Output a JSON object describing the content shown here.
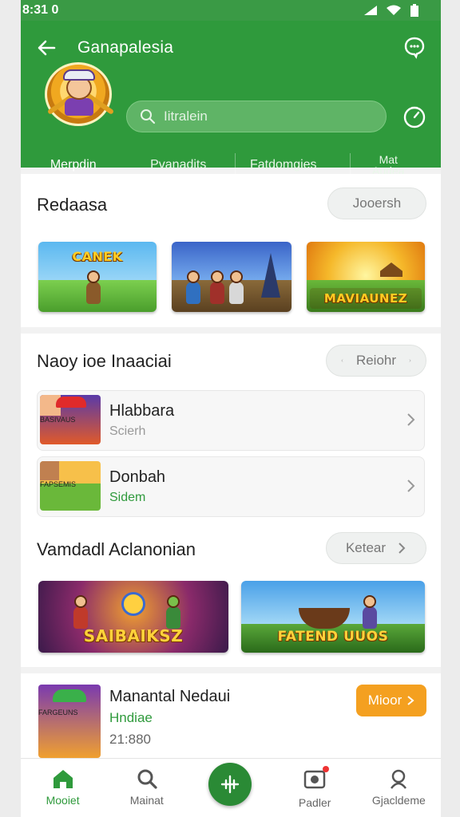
{
  "status_bar": {
    "time": "8:31 0"
  },
  "header": {
    "title": "Ganapalesia",
    "search_placeholder": "Iitralein",
    "colors": {
      "primary": "#2f9a3c",
      "accent": "#f4a020"
    }
  },
  "tabs": [
    {
      "label": "Merpdin",
      "active": true
    },
    {
      "label": "Pvanadits",
      "active": false
    },
    {
      "label": "Fatdomgies",
      "active": false
    },
    {
      "label": "Mat Audea",
      "active": false
    }
  ],
  "section1": {
    "title": "Redaasa",
    "button": "Jooersh",
    "games": [
      {
        "banner": "CANEK"
      },
      {
        "banner": ""
      },
      {
        "banner": "MAVIAUNEZ"
      }
    ]
  },
  "section2": {
    "title": "Naoy ioe Inaaciai",
    "button": "Reiohr",
    "items": [
      {
        "name": "Hlabbara",
        "sub": "Scierh",
        "icon_banner": "BASIVAUS"
      },
      {
        "name": "Donbah",
        "sub": "Sidem",
        "icon_banner": "FAPSEMIS"
      }
    ]
  },
  "section3": {
    "title": "Vamdadl Aclanonian",
    "button": "Ketear",
    "games": [
      {
        "banner": "SAIBAIKSZ"
      },
      {
        "banner": "FATEND UUOS"
      }
    ]
  },
  "featured": {
    "name": "Manantal Nedaui",
    "genre": "Hndiae",
    "count": "21:880",
    "icon_banner": "FARGEUNS",
    "button": "Mioor"
  },
  "bottom_nav": [
    {
      "label": "Mooiet",
      "icon": "home-icon",
      "active": true
    },
    {
      "label": "Mainat",
      "icon": "search-icon",
      "active": false
    },
    {
      "label": "Padler",
      "icon": "gamepad-icon",
      "active": false
    },
    {
      "label": "Gjacldeme",
      "icon": "profile-icon",
      "active": false
    }
  ]
}
